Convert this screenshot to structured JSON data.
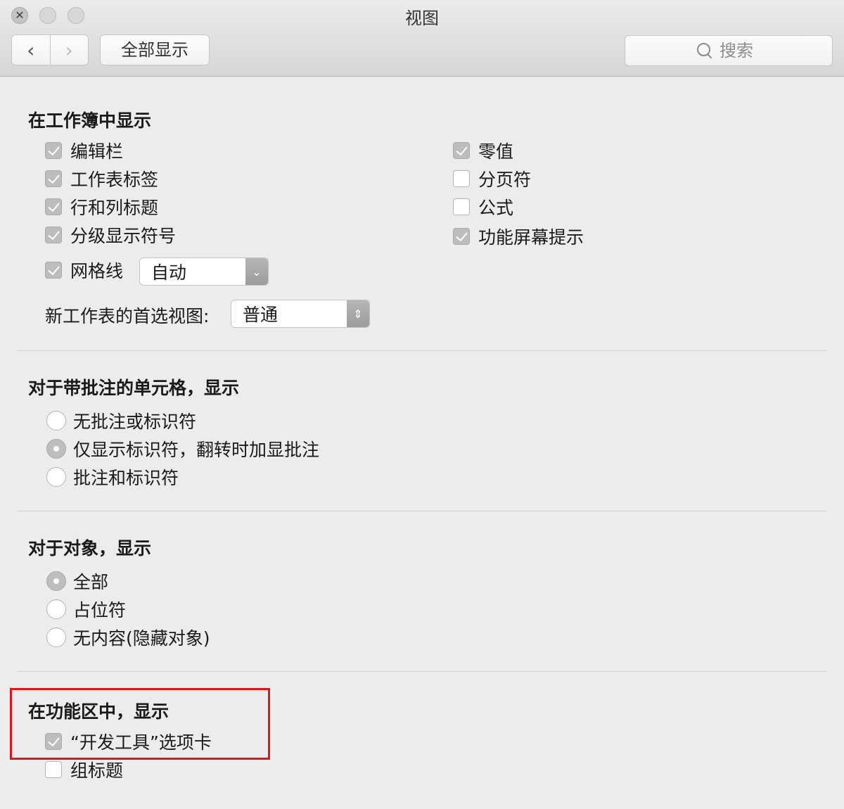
{
  "window": {
    "title": "视图"
  },
  "toolbar": {
    "back_icon": "chevron-left-icon",
    "forward_icon": "chevron-right-icon",
    "show_all_label": "全部显示",
    "search_placeholder": "搜索"
  },
  "workbook": {
    "title": "在工作簿中显示",
    "left_checks": [
      {
        "label": "编辑栏",
        "checked": true
      },
      {
        "label": "工作表标签",
        "checked": true
      },
      {
        "label": "行和列标题",
        "checked": true
      },
      {
        "label": "分级显示符号",
        "checked": true
      }
    ],
    "gridlines": {
      "label": "网格线",
      "checked": true,
      "select_value": "自动"
    },
    "right_checks": [
      {
        "label": "零值",
        "checked": true
      },
      {
        "label": "分页符",
        "checked": false
      },
      {
        "label": "公式",
        "checked": false
      },
      {
        "label": "功能屏幕提示",
        "checked": true
      }
    ],
    "preferred_view_label": "新工作表的首选视图:",
    "preferred_view_value": "普通"
  },
  "comments": {
    "title": "对于带批注的单元格，显示",
    "options": [
      {
        "label": "无批注或标识符",
        "selected": false
      },
      {
        "label": "仅显示标识符，翻转时加显批注",
        "selected": true
      },
      {
        "label": "批注和标识符",
        "selected": false
      }
    ]
  },
  "objects": {
    "title": "对于对象，显示",
    "options": [
      {
        "label": "全部",
        "selected": true
      },
      {
        "label": "占位符",
        "selected": false
      },
      {
        "label": "无内容(隐藏对象)",
        "selected": false
      }
    ]
  },
  "ribbon": {
    "title": "在功能区中，显示",
    "checks": [
      {
        "label": "“开发工具”选项卡",
        "checked": true
      },
      {
        "label": "组标题",
        "checked": false
      }
    ]
  },
  "colors": {
    "highlight": "#e0141e",
    "checked_fill": "#bdbdbd"
  }
}
